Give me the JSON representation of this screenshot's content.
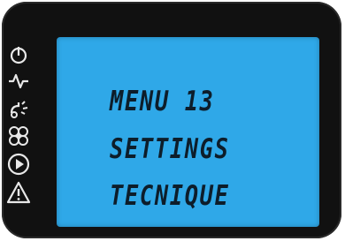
{
  "display": {
    "lines": [
      "MENU 13",
      "SETTINGS",
      "TECNIQUE"
    ]
  },
  "status_icons": [
    "power-icon",
    "electric-arc-icon",
    "shower-icon",
    "fan-icon",
    "play-icon",
    "warning-icon"
  ],
  "colors": {
    "bezel": "#111111",
    "lcd_background": "#2fa8e8",
    "lcd_text": "#0d1d2a",
    "icon_color": "#e8e8e8"
  }
}
